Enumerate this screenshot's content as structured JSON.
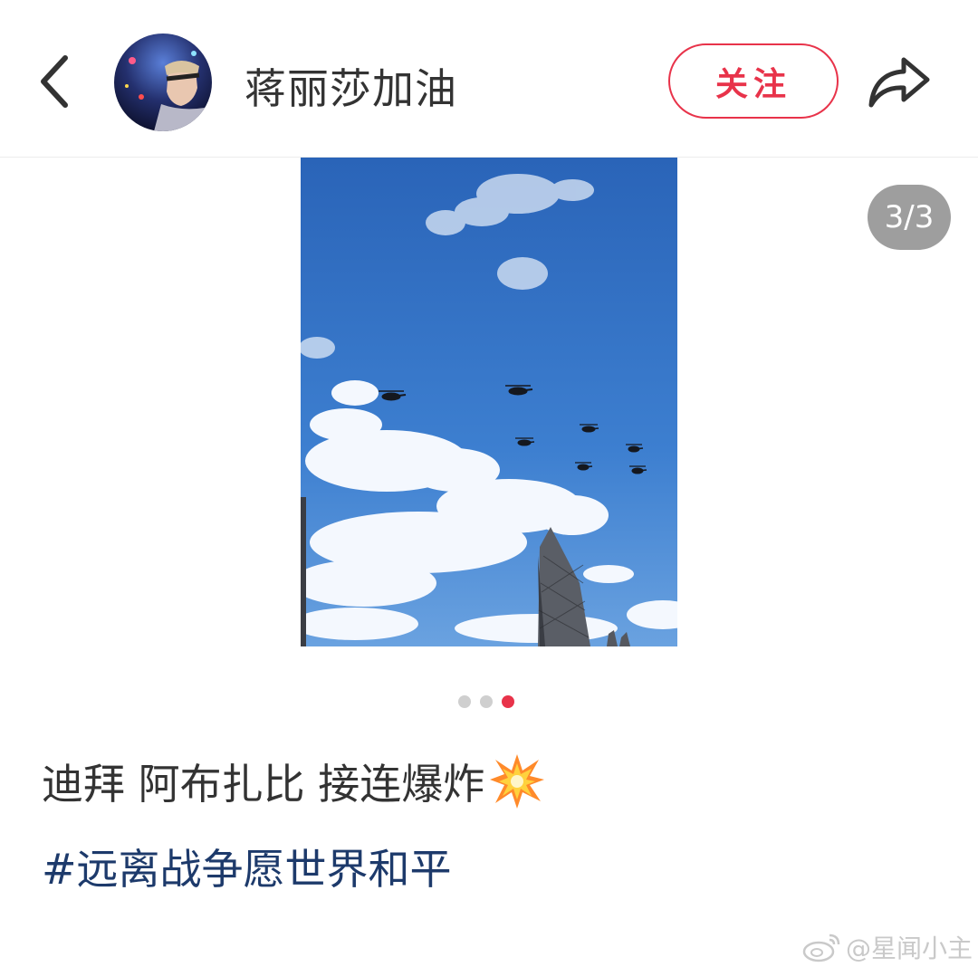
{
  "header": {
    "back_icon": "chevron-left-icon",
    "avatar_icon": "user-avatar",
    "user_name": "蒋丽莎加油",
    "follow_label": "关注",
    "share_icon": "share-arrow-icon",
    "accent_color": "#e8334a"
  },
  "gallery": {
    "counter": "3/3",
    "current_index": 3,
    "total": 3,
    "dots": [
      "dot-1",
      "dot-2",
      "dot-3"
    ],
    "photo_desc_icon": "photo"
  },
  "post": {
    "text": "迪拜 阿布扎比 接连爆炸",
    "emoji_icon": "collision-explosion-icon",
    "hashtag": "#远离战争愿世界和平",
    "hashtag_color": "#1d3a6b"
  },
  "watermark": {
    "icon": "weibo-logo-icon",
    "text": "@星闻小主"
  }
}
